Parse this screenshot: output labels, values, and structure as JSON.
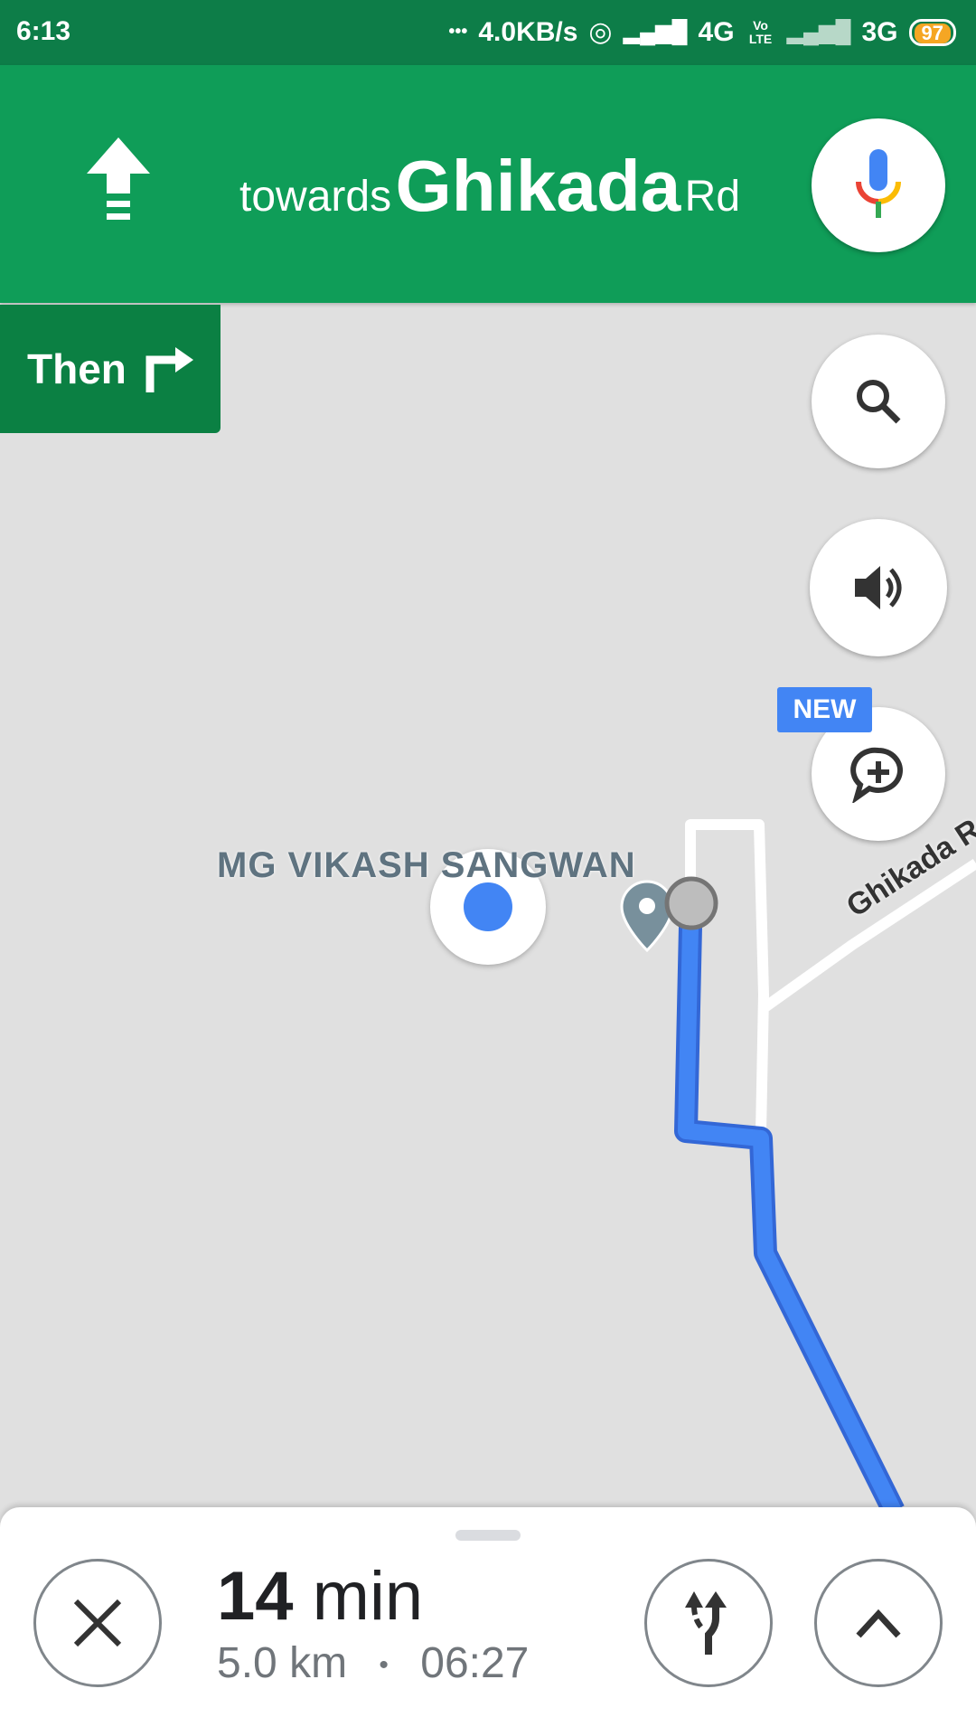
{
  "status_bar": {
    "time": "6:13",
    "dots": "•••",
    "speed": "4.0KB/s",
    "net1": "4G",
    "volte": "Vo LTE",
    "net2": "3G",
    "battery": "97"
  },
  "navigation": {
    "prefix": "towards",
    "street": "Ghikada",
    "suffix": "Rd",
    "maneuver_icon": "straight-arrow-icon",
    "then_label": "Then",
    "then_icon": "turn-right-icon"
  },
  "map": {
    "poi_label": "MG VIKASH SANGWAN",
    "road_label": "Ghikada Rd",
    "route_color": "#4285f4"
  },
  "controls": {
    "new_badge": "NEW"
  },
  "trip": {
    "duration_value": "14",
    "duration_unit": "min",
    "distance": "5.0 km",
    "separator": "•",
    "arrival": "06:27"
  },
  "colors": {
    "header": "#0f9d58",
    "status_bar": "#0d7d48",
    "then_box": "#0b8043"
  }
}
